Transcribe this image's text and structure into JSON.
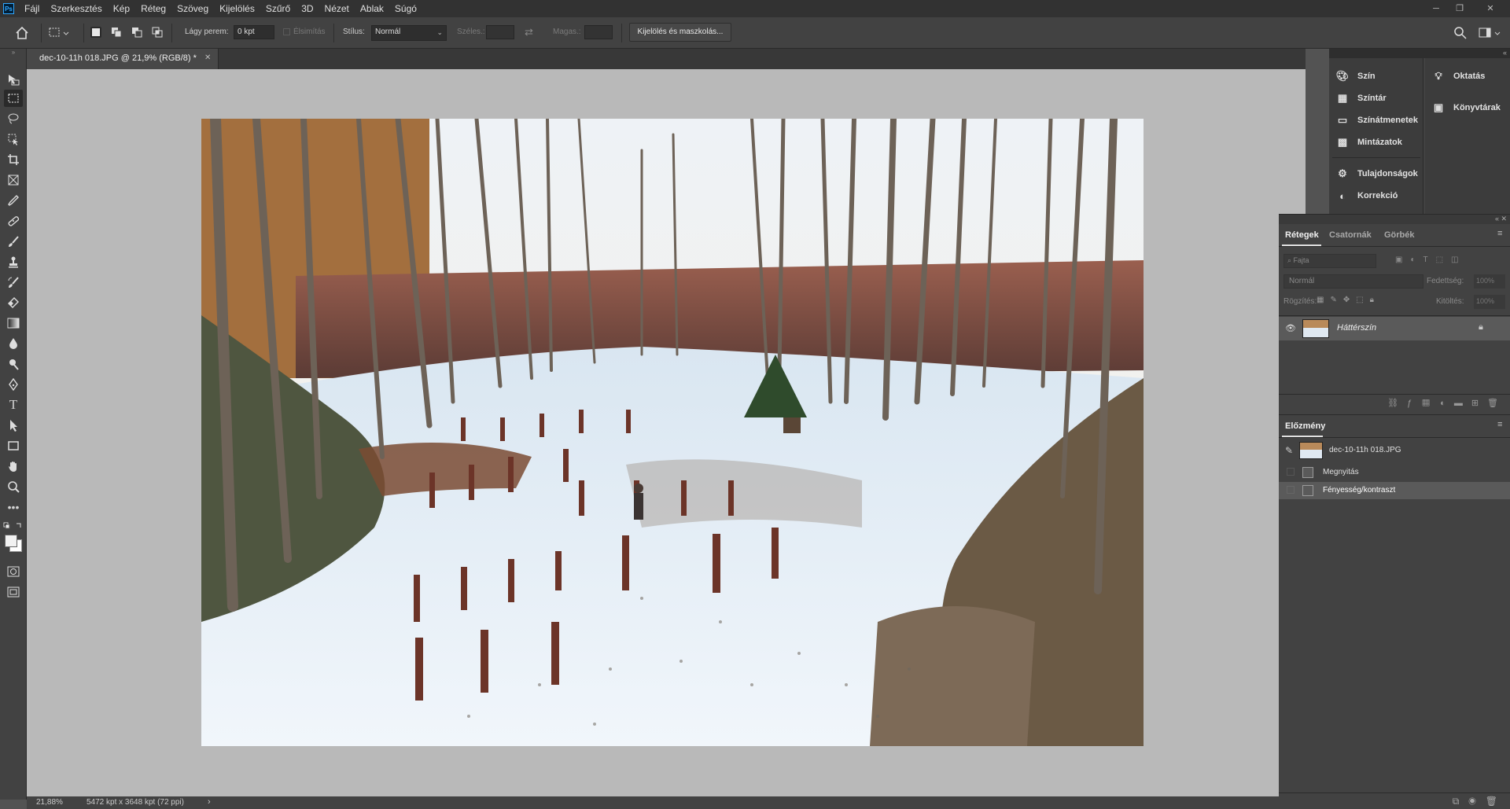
{
  "app": {
    "logo": "Ps"
  },
  "menu": [
    "Fájl",
    "Szerkesztés",
    "Kép",
    "Réteg",
    "Szöveg",
    "Kijelölés",
    "Szűrő",
    "3D",
    "Nézet",
    "Ablak",
    "Súgó"
  ],
  "options": {
    "feather_label": "Lágy perem:",
    "feather_value": "0 kpt",
    "antialias_label": "Élsimítás",
    "style_label": "Stílus:",
    "style_value": "Normál",
    "width_label": "Széles.:",
    "height_label": "Magas.:",
    "select_mask_button": "Kijelölés és maszkolás..."
  },
  "document": {
    "tab_title": "dec-10-11h 018.JPG @ 21,9% (RGB/8) *"
  },
  "status": {
    "zoom": "21,88%",
    "doc_size": "5472 kpt x 3648 kpt (72 ppi)"
  },
  "mini_panels": {
    "col1": [
      {
        "label": "Szín",
        "icon": "palette-icon"
      },
      {
        "label": "Színtár",
        "icon": "swatches-icon"
      },
      {
        "label": "Színátmenetek",
        "icon": "gradients-icon"
      },
      {
        "label": "Mintázatok",
        "icon": "patterns-icon"
      },
      {
        "label": "Tulajdonságok",
        "icon": "properties-icon"
      },
      {
        "label": "Korrekció",
        "icon": "adjustments-icon"
      }
    ],
    "col2": [
      {
        "label": "Oktatás",
        "icon": "learn-icon"
      },
      {
        "label": "Könyvtárak",
        "icon": "libraries-icon"
      }
    ]
  },
  "layers_panel": {
    "tabs": [
      "Rétegek",
      "Csatornák",
      "Görbék"
    ],
    "filter_placeholder": "Fajta",
    "blend_mode": "Normál",
    "opacity_label": "Fedettség:",
    "opacity_value": "100%",
    "lock_label": "Rögzítés:",
    "fill_label": "Kitöltés:",
    "fill_value": "100%",
    "layers": [
      {
        "name": "Háttérszín",
        "locked": true,
        "visible": true
      }
    ]
  },
  "history_panel": {
    "title": "Előzmény",
    "snapshot": "dec-10-11h 018.JPG",
    "states": [
      "Megnyitás",
      "Fényesség/kontraszt"
    ]
  }
}
